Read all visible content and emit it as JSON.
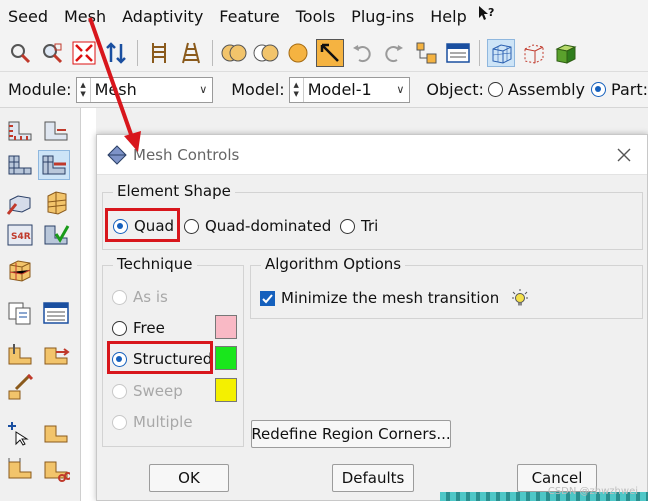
{
  "menubar": {
    "items": [
      "Seed",
      "Mesh",
      "Adaptivity",
      "Feature",
      "Tools",
      "Plug-ins",
      "Help"
    ],
    "help_pointer_icon": "whats-this-icon"
  },
  "toolbar": {
    "icons": [
      "query-icon",
      "zoom-icon",
      "fit-view-icon",
      "rotate-icon",
      "seed-edge-icon",
      "seed-part-icon",
      "union-icon",
      "intersect-icon",
      "sphere-icon",
      "pan-icon",
      "undo-icon",
      "redo-icon",
      "part-tree-icon",
      "display-icon",
      "wireframe-cube-icon",
      "hidden-cube-icon",
      "shaded-cube-icon"
    ]
  },
  "modulebar": {
    "module_label": "Module:",
    "module_value": "Mesh",
    "model_label": "Model:",
    "model_value": "Model-1",
    "object_label": "Object:",
    "object_options": [
      "Assembly",
      "Part:"
    ],
    "object_selected": "Part:"
  },
  "dialog": {
    "title": "Mesh Controls",
    "element_shape": {
      "title": "Element Shape",
      "options": [
        "Quad",
        "Quad-dominated",
        "Tri"
      ],
      "selected": "Quad"
    },
    "technique": {
      "title": "Technique",
      "options": [
        {
          "label": "As is",
          "enabled": false,
          "swatch": null
        },
        {
          "label": "Free",
          "enabled": true,
          "swatch": "#f9b9c5"
        },
        {
          "label": "Structured",
          "enabled": true,
          "swatch": "#19e61c"
        },
        {
          "label": "Sweep",
          "enabled": false,
          "swatch": "#f4f000"
        },
        {
          "label": "Multiple",
          "enabled": false,
          "swatch": null
        }
      ],
      "selected": "Structured"
    },
    "algorithm": {
      "title": "Algorithm Options",
      "minimize_label": "Minimize the mesh transition",
      "minimize_checked": true,
      "hint_icon": "lightbulb-icon"
    },
    "redefine_button": "Redefine Region Corners...",
    "buttons": {
      "ok": "OK",
      "defaults": "Defaults",
      "cancel": "Cancel"
    }
  },
  "watermark": "CSDN @zhwzhwei",
  "colors": {
    "highlight_red": "#d8161c",
    "radio_blue": "#1560bd",
    "free_swatch": "#f9b9c5",
    "structured_swatch": "#19e61c",
    "sweep_swatch": "#f4f000"
  }
}
